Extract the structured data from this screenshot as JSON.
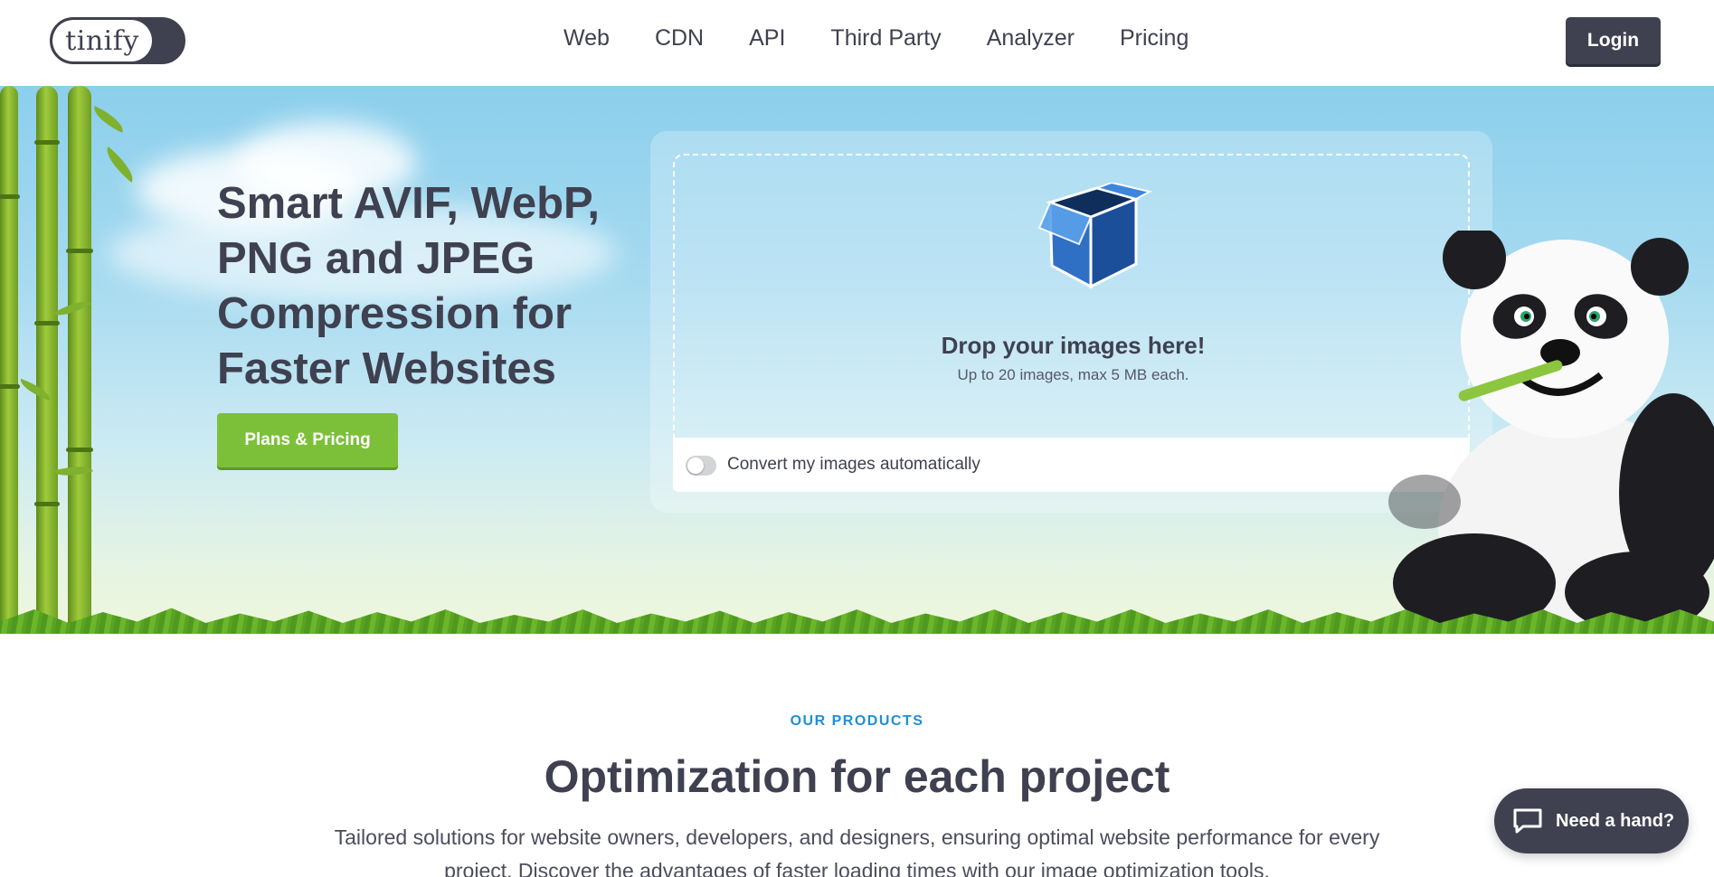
{
  "header": {
    "logo_text": "tinify",
    "nav": [
      "Web",
      "CDN",
      "API",
      "Third Party",
      "Analyzer",
      "Pricing"
    ],
    "login_label": "Login"
  },
  "hero": {
    "title": "Smart AVIF, WebP, PNG and JPEG Compression for Faster Websites",
    "cta_label": "Plans & Pricing",
    "dropzone": {
      "icon": "box-icon",
      "title": "Drop your images here!",
      "subtitle": "Up to 20 images, max 5 MB each.",
      "convert_label": "Convert my images automatically",
      "convert_enabled": false
    }
  },
  "products": {
    "eyebrow": "OUR PRODUCTS",
    "title": "Optimization for each project",
    "description": "Tailored solutions for website owners, developers, and designers, ensuring optimal website performance for every project. Discover the advantages of faster loading times with our image optimization tools."
  },
  "chat": {
    "label": "Need a hand?",
    "icon": "chat-bubble-icon"
  },
  "colors": {
    "brand_dark": "#3f4150",
    "cta_green": "#7cc03a",
    "eyebrow_blue": "#1f8fd6",
    "sky": "#8ccfec"
  }
}
